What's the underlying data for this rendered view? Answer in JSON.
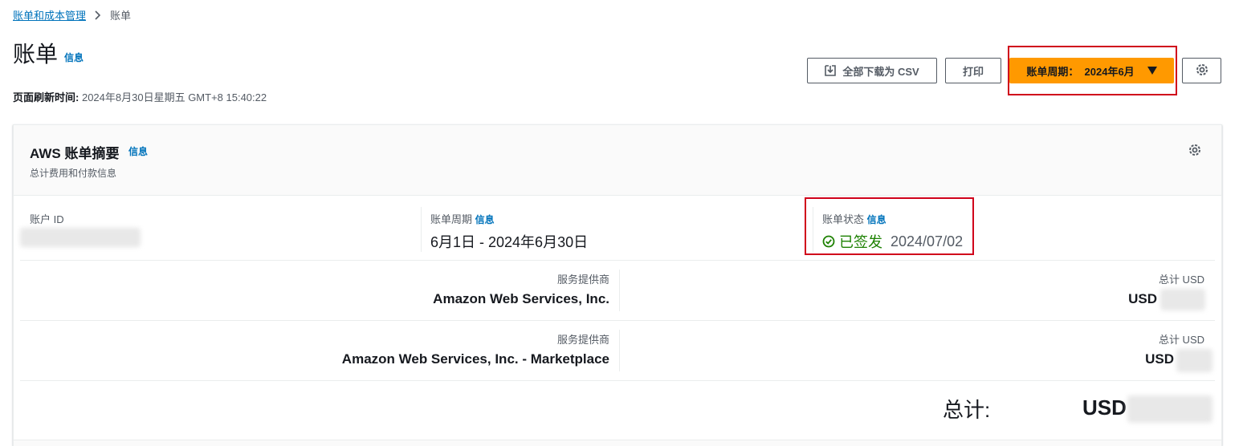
{
  "breadcrumb": {
    "parent": "账单和成本管理",
    "current": "账单"
  },
  "page": {
    "title": "账单",
    "info": "信息",
    "refresh_label": "页面刷新时间:",
    "refresh_value": "2024年8月30日星期五 GMT+8 15:40:22"
  },
  "toolbar": {
    "csv_label": "全部下载为 CSV",
    "print_label": "打印",
    "period_label": "账单周期：  2024年6月"
  },
  "summary": {
    "title": "AWS 账单摘要",
    "info": "信息",
    "subtitle": "总计费用和付款信息",
    "account_id_label": "账户 ID",
    "period_label": "账单周期",
    "period_info": "信息",
    "period_value": "6月1日 - 2024年6月30日",
    "status_label": "账单状态",
    "status_info": "信息",
    "status_value": "已签发",
    "status_date": "2024/07/02"
  },
  "providers": [
    {
      "label": "服务提供商",
      "name": "Amazon Web Services, Inc.",
      "total_label": "总计 USD",
      "total_value": "USD"
    },
    {
      "label": "服务提供商",
      "name": "Amazon Web Services, Inc. - Marketplace",
      "total_label": "总计 USD",
      "total_value": "USD"
    }
  ],
  "grand_total": {
    "label": "总计:",
    "value": "USD"
  },
  "colors": {
    "accent": "#ff9900",
    "link": "#0073bb",
    "success": "#1d8102",
    "highlight": "#d0021b"
  }
}
